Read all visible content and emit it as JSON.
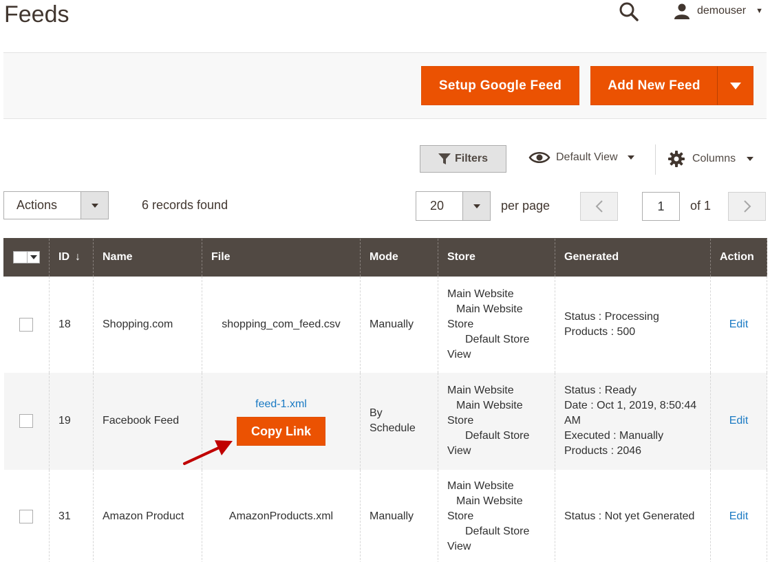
{
  "page": {
    "title": "Feeds"
  },
  "header": {
    "user_name": "demouser"
  },
  "toolbar": {
    "setup_google_feed": "Setup Google Feed",
    "add_new_feed": "Add New Feed",
    "filters_label": "Filters",
    "view_label": "Default View",
    "columns_label": "Columns"
  },
  "grid_controls": {
    "actions_label": "Actions",
    "records_found": "6 records found",
    "per_page_value": "20",
    "per_page_label": "per page",
    "page_current": "1",
    "page_of": "of 1"
  },
  "columns": [
    "ID",
    "Name",
    "File",
    "Mode",
    "Store",
    "Generated",
    "Action"
  ],
  "rows": [
    {
      "id": "18",
      "name": "Shopping.com",
      "file": "shopping_com_feed.csv",
      "mode": "Manually",
      "store": [
        "Main Website",
        "Main Website",
        "Store",
        "Default Store",
        "View"
      ],
      "generated": [
        "Status : Processing",
        "Products : 500"
      ],
      "action": "Edit"
    },
    {
      "id": "19",
      "name": "Facebook Feed",
      "file": "feed-1.xml",
      "copy_link": "Copy Link",
      "mode": "By Schedule",
      "store": [
        "Main Website",
        "Main Website",
        "Store",
        "Default Store",
        "View"
      ],
      "generated": [
        "Status : Ready",
        "Date : Oct 1, 2019, 8:50:44",
        "AM",
        "Executed : Manually",
        "Products : 2046"
      ],
      "action": "Edit"
    },
    {
      "id": "31",
      "name": "Amazon Product",
      "file": "AmazonProducts.xml",
      "mode": "Manually",
      "store": [
        "Main Website",
        "Main Website",
        "Store",
        "Default Store",
        "View"
      ],
      "generated": [
        "Status : Not yet Generated"
      ],
      "action": "Edit"
    }
  ],
  "colors": {
    "accent": "#eb5202",
    "header_bg": "#514943",
    "link": "#1979c3",
    "annotation_arrow": "#c00000"
  }
}
